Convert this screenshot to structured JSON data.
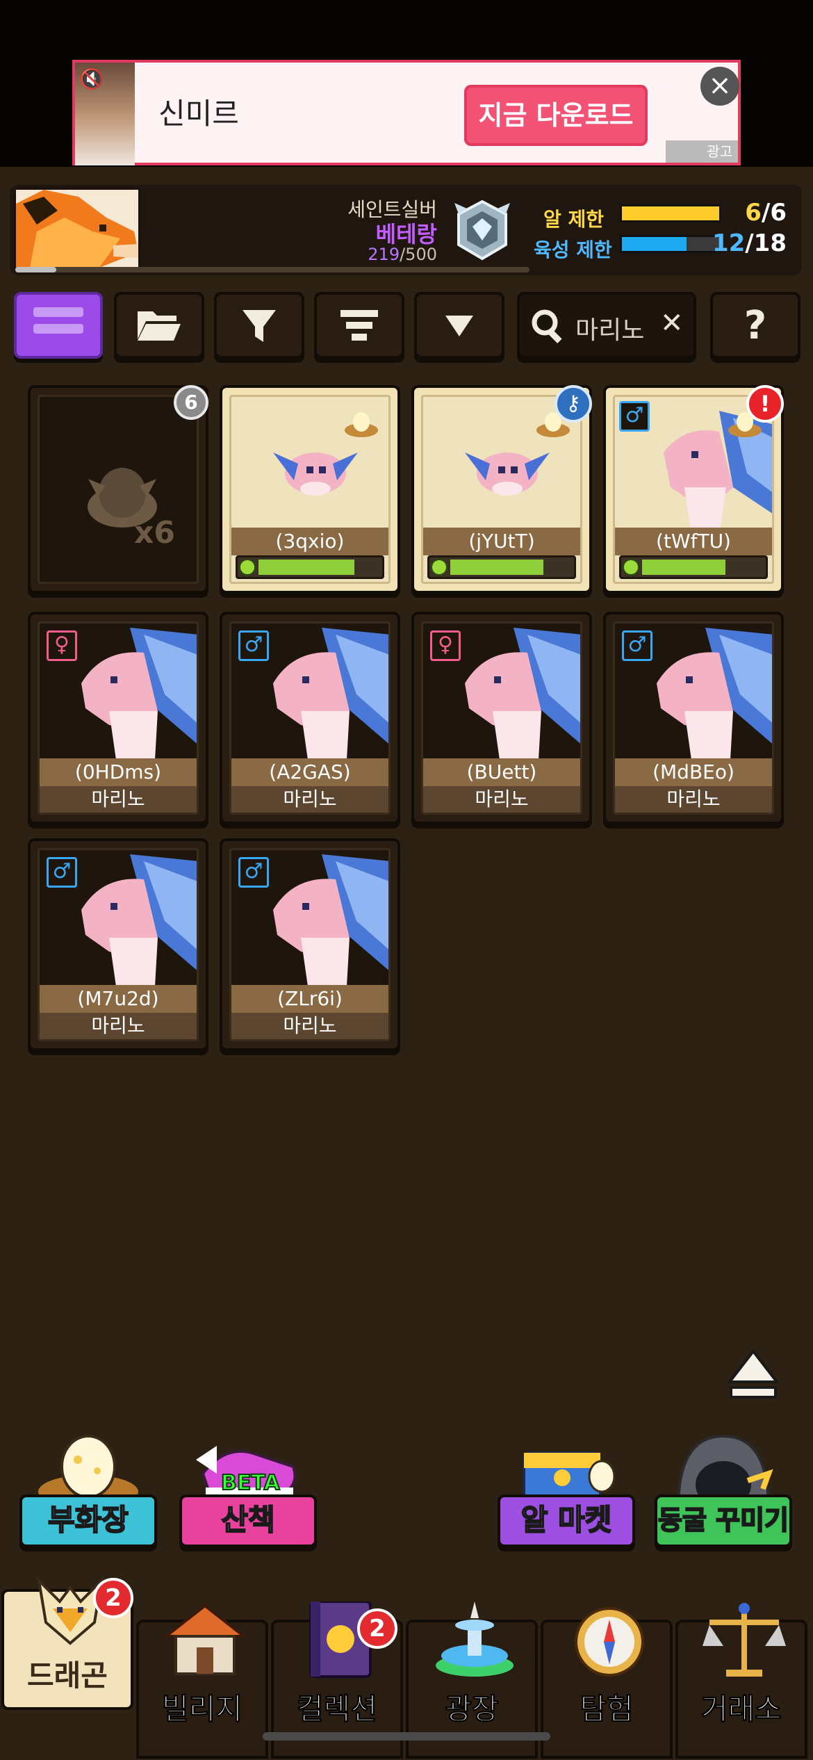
{
  "ad": {
    "app_name": "신미르",
    "cta": "지금 다운로드",
    "tag": "광고"
  },
  "header": {
    "rank_title": "세인트실버",
    "rank_sub": "베테랑",
    "rank_points_current": "219",
    "rank_points_max": "/500",
    "egg_limit_label": "알 제한",
    "egg_limit_current": "6",
    "egg_limit_max": "/6",
    "egg_limit_fill": 1.0,
    "breed_limit_label": "육성 제한",
    "breed_limit_current": "12",
    "breed_limit_max": "/18",
    "breed_limit_fill": 0.667,
    "colors": {
      "egg": "#ffcc2a",
      "breed": "#1eaaf0",
      "rank_sub": "#c25cff"
    }
  },
  "search": {
    "value": "마리노"
  },
  "grid": {
    "egg_slot": {
      "badge": "6",
      "count": "x6"
    },
    "eggs": [
      {
        "name": "(3qxio)",
        "progress": 0.8
      },
      {
        "name": "(jYUtT)",
        "progress": 0.78
      },
      {
        "name": "(tWfTU)",
        "progress": 0.7
      }
    ],
    "dragons": [
      {
        "name": "(0HDms)",
        "species": "마리노",
        "gender": "♀"
      },
      {
        "name": "(A2GAS)",
        "species": "마리노",
        "gender": "♂"
      },
      {
        "name": "(BUett)",
        "species": "마리노",
        "gender": "♀"
      },
      {
        "name": "(MdBEo)",
        "species": "마리노",
        "gender": "♂"
      },
      {
        "name": "(M7u2d)",
        "species": "마리노",
        "gender": "♂"
      },
      {
        "name": "(ZLr6i)",
        "species": "마리노",
        "gender": "♂"
      }
    ],
    "egg3_gender": "♂",
    "egg3_alert": "!"
  },
  "actions": {
    "incubator": "부화장",
    "walk": "산책",
    "walk_badge": "BETA",
    "egg_market": "알 마켓",
    "cave_decor": "동굴 꾸미기"
  },
  "nav": {
    "dragon": "드래곤",
    "dragon_badge": "2",
    "village": "빌리지",
    "collection": "컬렉션",
    "collection_badge": "2",
    "plaza": "광장",
    "explore": "탐험",
    "exchange": "거래소"
  }
}
